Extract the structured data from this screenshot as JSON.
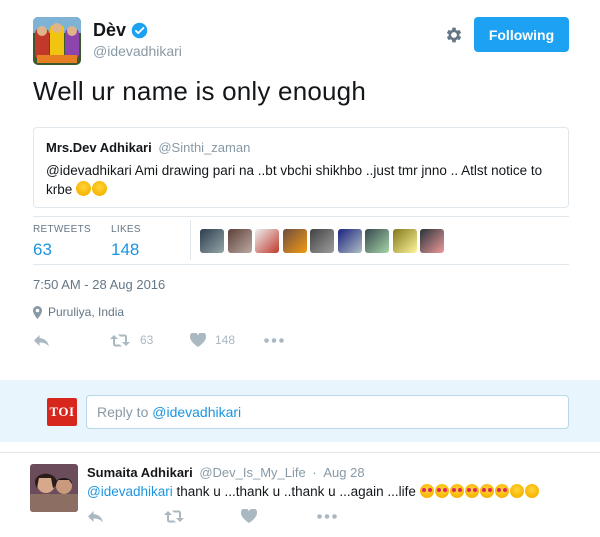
{
  "tweet": {
    "author_name": "Dèv",
    "author_handle": "@idevadhikari",
    "follow_label": "Following",
    "text": "Well ur name is only enough",
    "quote": {
      "name": "Mrs.Dev Adhikari",
      "handle": "@Sinthi_zaman",
      "text": "@idevadhikari Ami drawing pari na ..bt vbchi shikhbo ..just tmr jnno .. Atlst notice to krbe"
    },
    "stats": {
      "retweets_label": "RETWEETS",
      "retweets": "63",
      "likes_label": "LIKES",
      "likes": "148"
    },
    "likers_count": 9,
    "timestamp": "7:50 AM - 28 Aug 2016",
    "location": "Puruliya, India",
    "actions": {
      "retweet_count": "63",
      "like_count": "148"
    }
  },
  "reply_composer": {
    "logo_text": "TOI",
    "placeholder_prefix": "Reply to ",
    "placeholder_mention": "@idevadhikari"
  },
  "reply": {
    "name": "Sumaita Adhikari",
    "handle": "@Dev_Is_My_Life",
    "separator": "·",
    "date": "Aug 28",
    "mention": "@idevadhikari",
    "text": " thank u ...thank u ..thank u ...again ...life"
  },
  "colors": {
    "accent": "#1da1f2",
    "link": "#1b95e0",
    "muted": "#8899a6",
    "reply_bg": "#e8f5fd",
    "toi_red": "#d7261c"
  }
}
